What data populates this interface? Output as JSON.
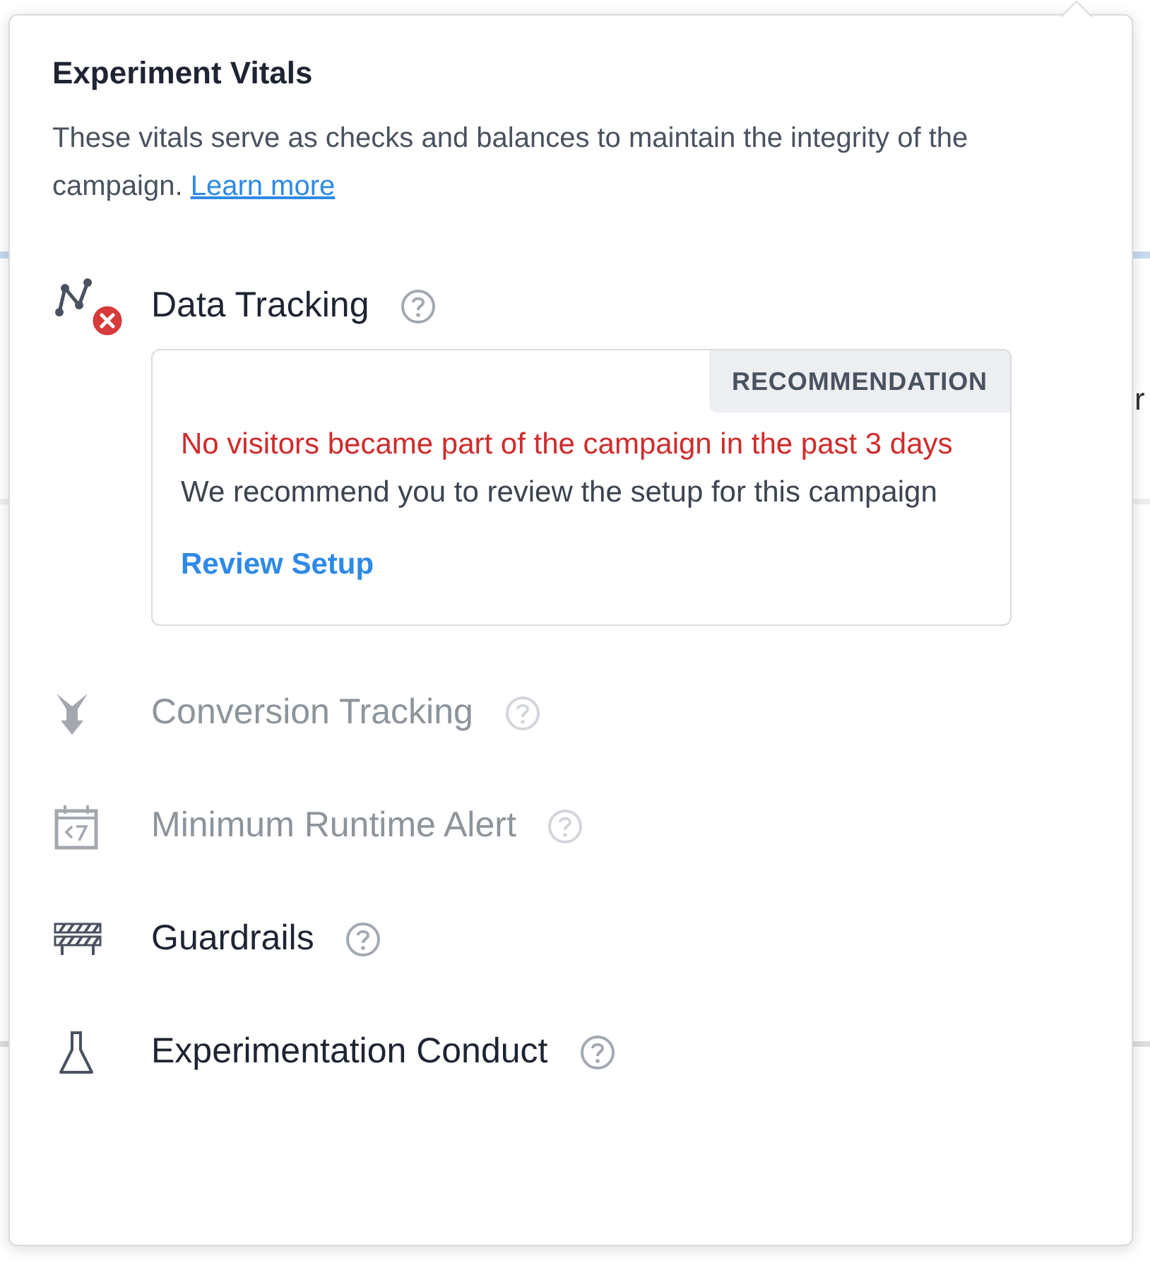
{
  "background_fragment": "r",
  "popover": {
    "title": "Experiment Vitals",
    "description": "These vitals serve as checks and balances to maintain the integrity of the campaign.",
    "link": "Learn more"
  },
  "vitals": [
    {
      "kind": "tracking",
      "label": "Data Tracking",
      "disabled": false,
      "error": true,
      "recommendation": {
        "badge": "RECOMMENDATION",
        "alert": "No visitors became part of the campaign in the past 3 days",
        "message": "We recommend you to review the setup for this campaign",
        "action": "Review Setup"
      }
    },
    {
      "kind": "conversion",
      "label": "Conversion Tracking",
      "disabled": true,
      "error": false
    },
    {
      "kind": "runtime",
      "label": "Minimum Runtime Alert",
      "disabled": true,
      "error": false
    },
    {
      "kind": "guardrails",
      "label": "Guardrails",
      "disabled": false,
      "error": false
    },
    {
      "kind": "conduct",
      "label": "Experimentation Conduct",
      "disabled": false,
      "error": false
    }
  ]
}
